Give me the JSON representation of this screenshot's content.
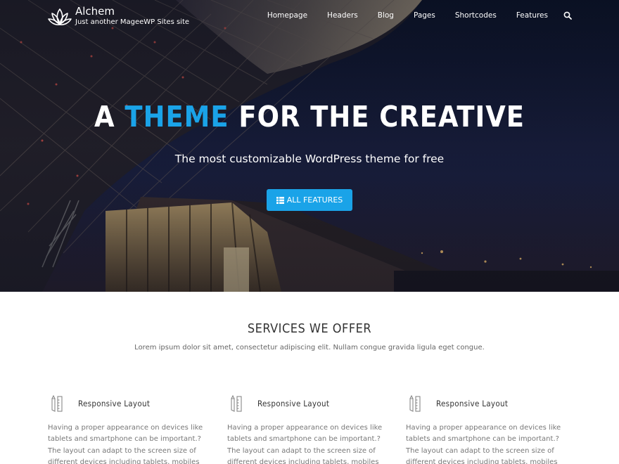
{
  "site": {
    "title": "Alchem",
    "tagline": "Just another MageeWP Sites site"
  },
  "nav": {
    "items": [
      "Homepage",
      "Headers",
      "Blog",
      "Pages",
      "Shortcodes",
      "Features"
    ],
    "search_icon": "search-icon"
  },
  "hero": {
    "title_part1": "A ",
    "title_accent": "THEME",
    "title_part2": " FOR THE CREATIVE",
    "subtitle": "The most customizable WordPress theme for free",
    "button_label": "ALL FEATURES",
    "button_icon": "list-icon",
    "accent_color": "#1aa3e8"
  },
  "services": {
    "title": "SERVICES WE OFFER",
    "description": "Lorem ipsum dolor sit amet, consectetur adipiscing elit. Nullam congue gravida ligula eget congue.",
    "items": [
      {
        "icon": "pencil-ruler-icon",
        "title": "Responsive Layout",
        "text": "Having a proper appearance on devices like tablets and smartphone can be important.?The layout can adapt to the screen size of different devices including tablets, mobiles and desktops."
      },
      {
        "icon": "pencil-ruler-icon",
        "title": "Responsive Layout",
        "text": "Having a proper appearance on devices like tablets and smartphone can be important.?The layout can adapt to the screen size of different devices including tablets, mobiles and desktops."
      },
      {
        "icon": "pencil-ruler-icon",
        "title": "Responsive Layout",
        "text": "Having a proper appearance on devices like tablets and smartphone can be important.?The layout can adapt to the screen size of different devices including tablets, mobiles and desktops."
      }
    ]
  }
}
